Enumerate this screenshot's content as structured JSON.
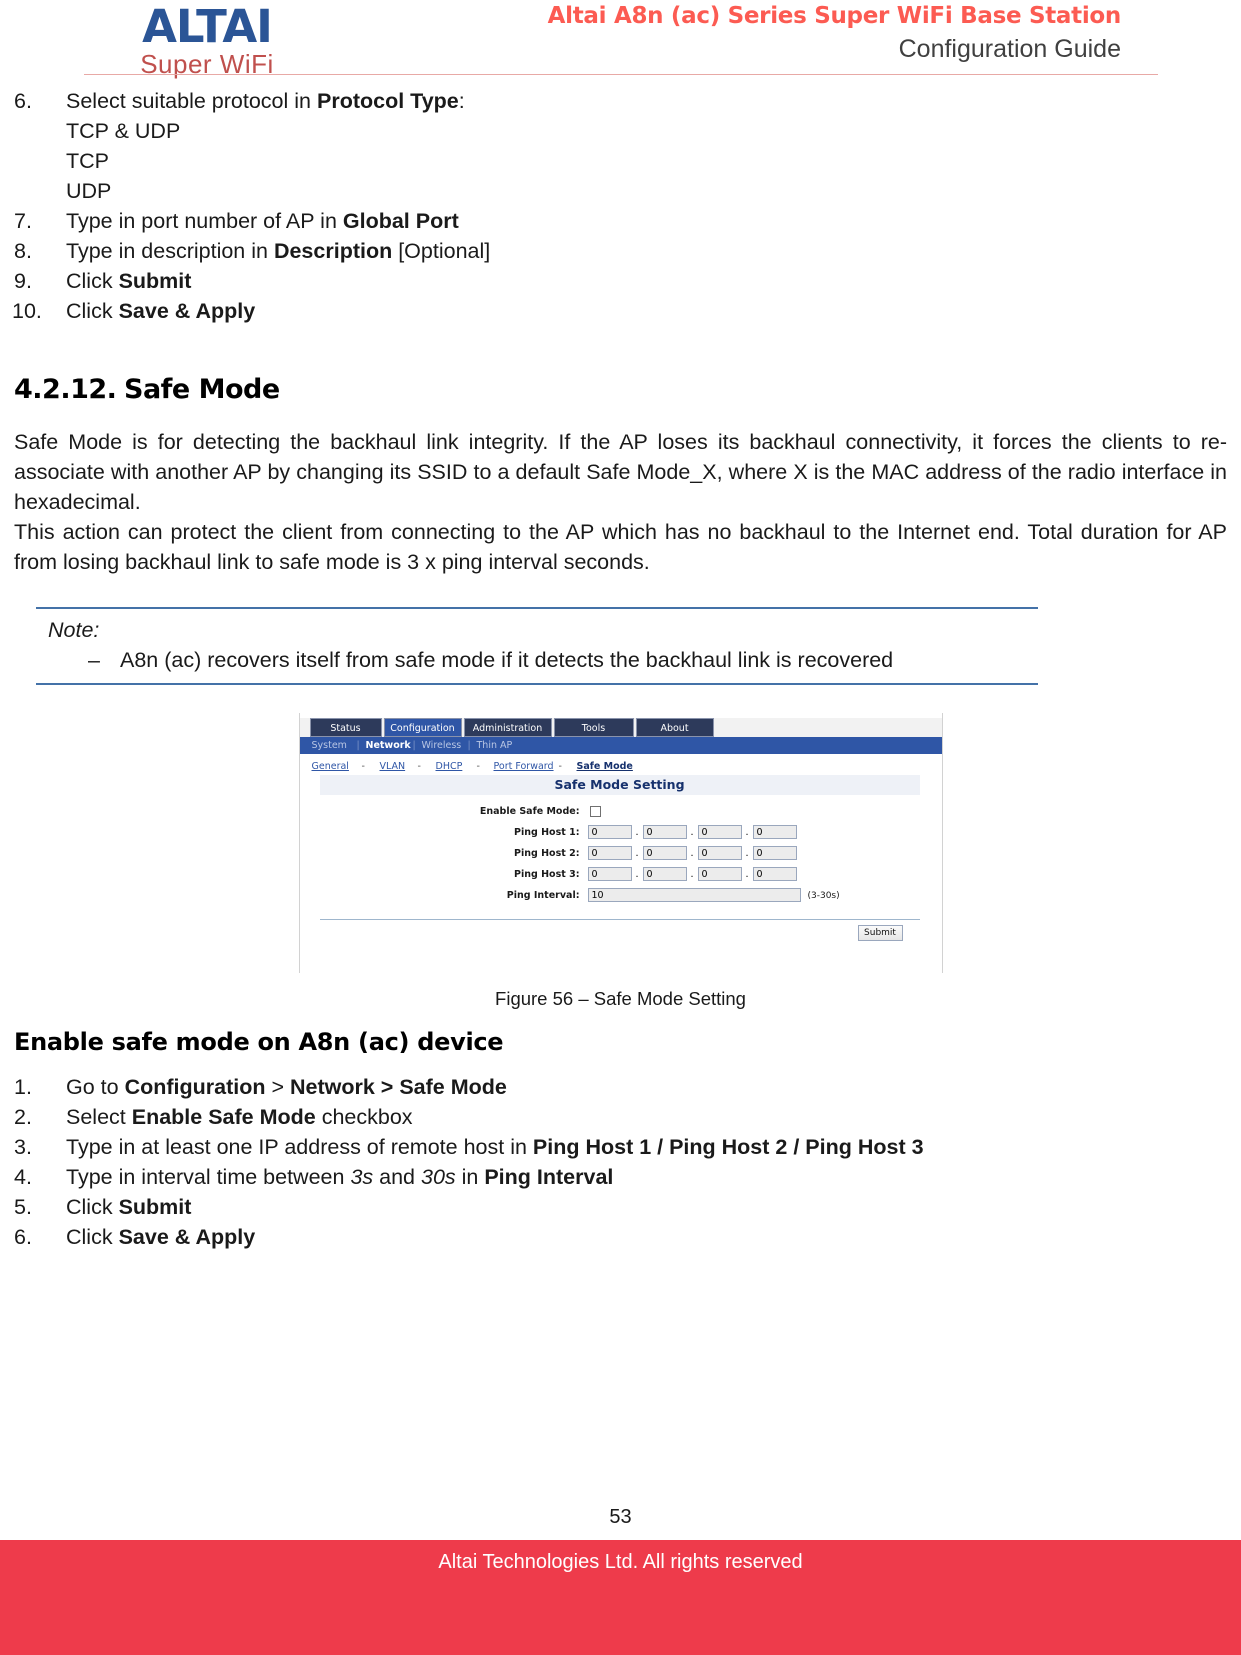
{
  "header": {
    "logo_main": "ALTAI",
    "logo_sub": "Super WiFi",
    "title_line1": "Altai A8n (ac) Series Super WiFi Base Station",
    "title_line2": "Configuration Guide",
    "rule_color": "#e8a9a6",
    "title_color": "#fc5b52"
  },
  "top_list": {
    "item6_num": "6.",
    "item6_pre": "Select suitable protocol in ",
    "item6_bold": "Protocol Type",
    "item6_post": ":",
    "item6_sub1": "TCP & UDP",
    "item6_sub2": "TCP",
    "item6_sub3": "UDP",
    "item7_num": "7.",
    "item7_pre": "Type in port number of AP in ",
    "item7_bold": "Global Port",
    "item8_num": "8.",
    "item8_pre": "Type in description in ",
    "item8_bold": "Description",
    "item8_post": " [Optional]",
    "item9_num": "9.",
    "item9_pre": "Click ",
    "item9_bold": "Submit",
    "item10_num": "10.",
    "item10_pre": "Click ",
    "item10_bold": "Save & Apply"
  },
  "section": {
    "number": "4.2.12.",
    "title": "Safe Mode",
    "para1": "Safe Mode is for detecting the backhaul link integrity. If the AP loses its backhaul connectivity, it forces the clients to re-associate with another AP by changing its SSID to a default Safe Mode_X, where X is the MAC address of the radio interface in hexadecimal.",
    "para2": "This action can protect the client from connecting to the AP which has no backhaul to the Internet end. Total duration for AP from losing backhaul link to safe mode is 3 x ping interval seconds."
  },
  "note": {
    "label": "Note:",
    "dash": "–",
    "text": "A8n (ac) recovers itself from safe mode if it detects the backhaul link is recovered",
    "border_color": "#4472a8"
  },
  "figure": {
    "caption": "Figure 56 – Safe Mode Setting",
    "app": {
      "tabs": [
        {
          "label": "Status",
          "active": false
        },
        {
          "label": "Configuration",
          "active": true
        },
        {
          "label": "Administration",
          "active": false
        },
        {
          "label": "Tools",
          "active": false
        },
        {
          "label": "About",
          "active": false
        }
      ],
      "subnav": [
        {
          "label": "System",
          "current": false
        },
        {
          "label": "Network",
          "current": true
        },
        {
          "label": "Wireless",
          "current": false
        },
        {
          "label": "Thin AP",
          "current": false
        }
      ],
      "crumbs": [
        {
          "label": "General",
          "current": false
        },
        {
          "label": "VLAN",
          "current": false
        },
        {
          "label": "DHCP",
          "current": false
        },
        {
          "label": "Port Forward",
          "current": false
        },
        {
          "label": "Safe Mode",
          "current": true
        }
      ],
      "crumb_sep": "-",
      "panel_title": "Safe Mode Setting",
      "fields": {
        "enable_label": "Enable Safe Mode:",
        "enable_checked": false,
        "ping_host_1_label": "Ping Host 1:",
        "ping_host_1": [
          "0",
          "0",
          "0",
          "0"
        ],
        "ping_host_2_label": "Ping Host 2:",
        "ping_host_2": [
          "0",
          "0",
          "0",
          "0"
        ],
        "ping_host_3_label": "Ping Host 3:",
        "ping_host_3": [
          "0",
          "0",
          "0",
          "0"
        ],
        "ping_interval_label": "Ping Interval:",
        "ping_interval_value": "10",
        "ping_interval_hint": "(3-30s)",
        "octet_sep": "."
      },
      "submit_label": "Submit",
      "accent_color": "#2f56a6"
    }
  },
  "subsection": {
    "title": "Enable safe mode on A8n (ac) device",
    "steps": {
      "s1_num": "1.",
      "s1_pre": "Go to ",
      "s1_b1": "Configuration",
      "s1_mid": " > ",
      "s1_b2": "Network > Safe Mode",
      "s2_num": "2.",
      "s2_pre": "Select ",
      "s2_bold": "Enable Safe Mode",
      "s2_post": " checkbox",
      "s3_num": "3.",
      "s3_pre": "Type in at least one IP address of remote host in ",
      "s3_bold": "Ping Host 1 / Ping Host 2 / Ping Host 3",
      "s4_num": "4.",
      "s4_pre": "Type in interval time between ",
      "s4_i1": "3s",
      "s4_mid": " and ",
      "s4_i2": "30s",
      "s4_post": " in ",
      "s4_bold": "Ping Interval",
      "s5_num": "5.",
      "s5_pre": "Click ",
      "s5_bold": "Submit",
      "s6_num": "6.",
      "s6_pre": "Click ",
      "s6_bold": "Save & Apply"
    }
  },
  "footer": {
    "page_number": "53",
    "copyright": "Altai Technologies Ltd. All rights reserved",
    "bar_color": "#ee3b4b"
  }
}
